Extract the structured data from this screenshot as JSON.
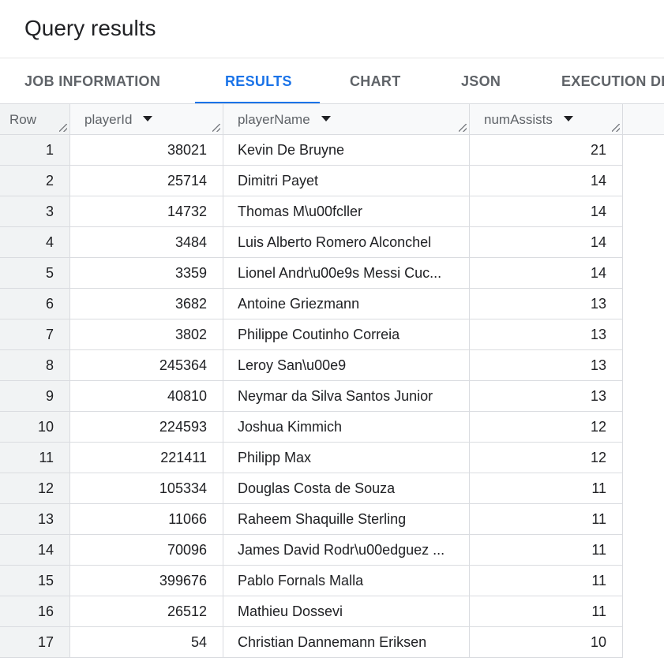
{
  "title": "Query results",
  "tabs": [
    {
      "label": "JOB INFORMATION",
      "active": false
    },
    {
      "label": "RESULTS",
      "active": true
    },
    {
      "label": "CHART",
      "active": false
    },
    {
      "label": "JSON",
      "active": false
    },
    {
      "label": "EXECUTION DE",
      "active": false
    }
  ],
  "columns": {
    "row": "Row",
    "playerId": "playerId",
    "playerName": "playerName",
    "numAssists": "numAssists"
  },
  "rows": [
    {
      "row": "1",
      "playerId": "38021",
      "playerName": "Kevin De Bruyne",
      "numAssists": "21"
    },
    {
      "row": "2",
      "playerId": "25714",
      "playerName": "Dimitri  Payet",
      "numAssists": "14"
    },
    {
      "row": "3",
      "playerId": "14732",
      "playerName": "Thomas M\\u00fcller",
      "numAssists": "14"
    },
    {
      "row": "4",
      "playerId": "3484",
      "playerName": "Luis Alberto Romero Alconchel",
      "numAssists": "14"
    },
    {
      "row": "5",
      "playerId": "3359",
      "playerName": "Lionel Andr\\u00e9s Messi Cuc...",
      "numAssists": "14"
    },
    {
      "row": "6",
      "playerId": "3682",
      "playerName": "Antoine Griezmann",
      "numAssists": "13"
    },
    {
      "row": "7",
      "playerId": "3802",
      "playerName": "Philippe Coutinho Correia",
      "numAssists": "13"
    },
    {
      "row": "8",
      "playerId": "245364",
      "playerName": "Leroy San\\u00e9",
      "numAssists": "13"
    },
    {
      "row": "9",
      "playerId": "40810",
      "playerName": "Neymar da Silva Santos Junior",
      "numAssists": "13"
    },
    {
      "row": "10",
      "playerId": "224593",
      "playerName": "Joshua Kimmich",
      "numAssists": "12"
    },
    {
      "row": "11",
      "playerId": "221411",
      "playerName": "Philipp Max",
      "numAssists": "12"
    },
    {
      "row": "12",
      "playerId": "105334",
      "playerName": "Douglas  Costa de Souza",
      "numAssists": "11"
    },
    {
      "row": "13",
      "playerId": "11066",
      "playerName": "Raheem Shaquille Sterling",
      "numAssists": "11"
    },
    {
      "row": "14",
      "playerId": "70096",
      "playerName": "James David Rodr\\u00edguez ...",
      "numAssists": "11"
    },
    {
      "row": "15",
      "playerId": "399676",
      "playerName": "Pablo Fornals Malla",
      "numAssists": "11"
    },
    {
      "row": "16",
      "playerId": "26512",
      "playerName": "Mathieu Dossevi",
      "numAssists": "11"
    },
    {
      "row": "17",
      "playerId": "54",
      "playerName": "Christian  Dannemann Eriksen",
      "numAssists": "10"
    }
  ]
}
